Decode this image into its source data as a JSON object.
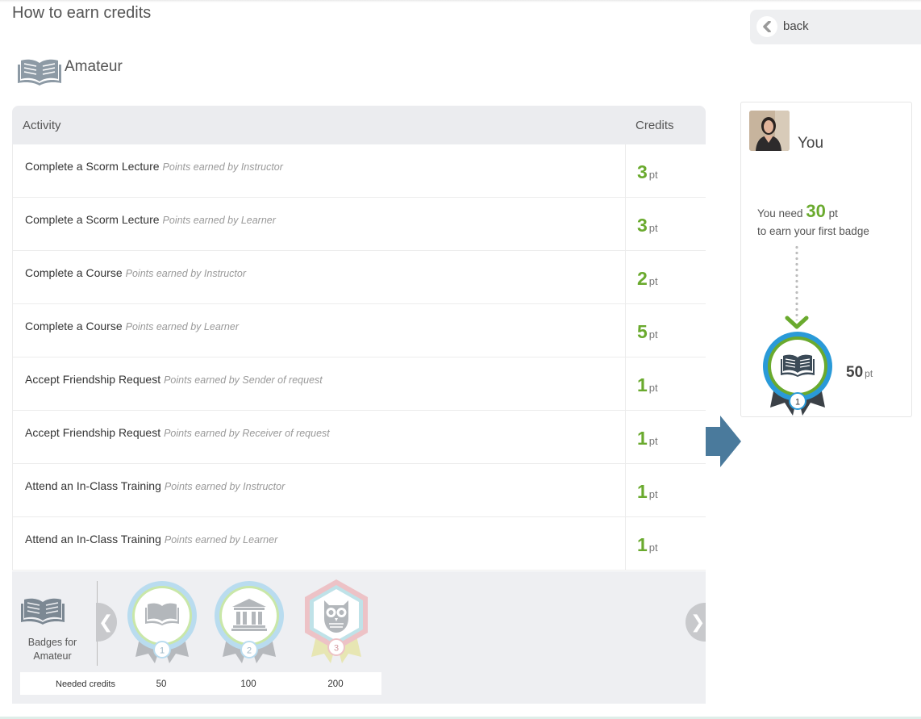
{
  "page": {
    "title": "How to earn credits",
    "back_label": "back"
  },
  "level": {
    "name": "Amateur",
    "icon": "open-book-icon"
  },
  "table": {
    "header": {
      "activity": "Activity",
      "credits": "Credits"
    },
    "unit": "pt",
    "rows": [
      {
        "activity": "Complete a Scorm Lecture",
        "earned_by": "Points earned by Instructor",
        "points": "3"
      },
      {
        "activity": "Complete a Scorm Lecture",
        "earned_by": "Points earned by Learner",
        "points": "3"
      },
      {
        "activity": "Complete a Course",
        "earned_by": "Points earned by Instructor",
        "points": "2"
      },
      {
        "activity": "Complete a Course",
        "earned_by": "Points earned by Learner",
        "points": "5"
      },
      {
        "activity": "Accept Friendship Request",
        "earned_by": "Points earned by Sender of request",
        "points": "1"
      },
      {
        "activity": "Accept Friendship Request",
        "earned_by": "Points earned by Receiver of request",
        "points": "1"
      },
      {
        "activity": "Attend an In-Class Training",
        "earned_by": "Points earned by Instructor",
        "points": "1"
      },
      {
        "activity": "Attend an In-Class Training",
        "earned_by": "Points earned by Learner",
        "points": "1"
      }
    ]
  },
  "badges": {
    "label": "Badges for Amateur",
    "needed_label": "Needed credits",
    "nav_prev": "❮",
    "nav_next": "❯",
    "items": [
      {
        "number": "1",
        "icon": "open-book-icon",
        "needed": "50"
      },
      {
        "number": "2",
        "icon": "bank-building-icon",
        "needed": "100"
      },
      {
        "number": "3",
        "icon": "owl-icon",
        "needed": "200"
      }
    ]
  },
  "you": {
    "name": "You",
    "need_prefix": "You need",
    "need_points": "30",
    "need_unit": "pt",
    "need_suffix": "to earn your first badge",
    "badge_number": "1",
    "badge_needed": "50",
    "badge_unit": "pt"
  },
  "colors": {
    "accent_green": "#6aaa2e",
    "badge_blue": "#2a9ad8",
    "arrow": "#4a7a9c"
  }
}
